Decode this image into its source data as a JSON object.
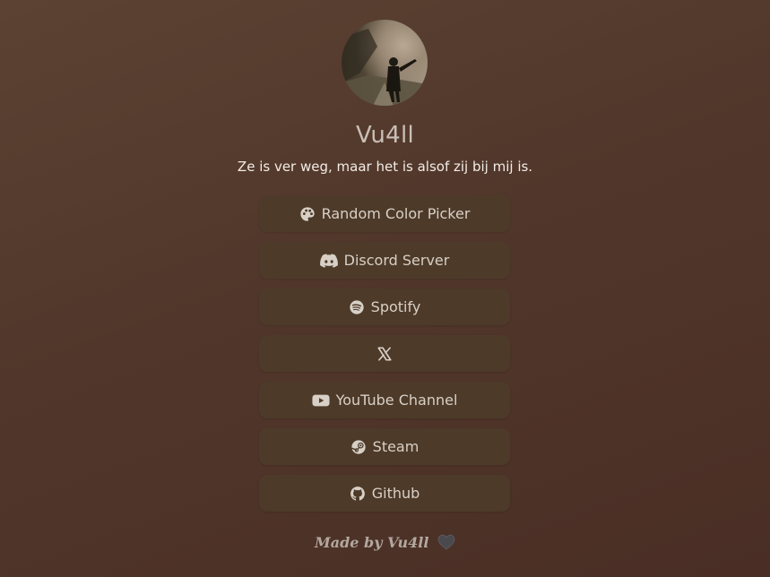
{
  "profile": {
    "username": "Vu4ll",
    "bio": "Ze is ver weg, maar het is alsof zij bij mij is."
  },
  "links": [
    {
      "label": "Random Color Picker",
      "icon": "palette-icon"
    },
    {
      "label": "Discord Server",
      "icon": "discord-icon"
    },
    {
      "label": "Spotify",
      "icon": "spotify-icon"
    },
    {
      "label": "",
      "icon": "x-icon"
    },
    {
      "label": "YouTube Channel",
      "icon": "youtube-icon"
    },
    {
      "label": "Steam",
      "icon": "steam-icon"
    },
    {
      "label": "Github",
      "icon": "github-icon"
    }
  ],
  "footer": {
    "text": "Made by Vu4ll",
    "icon": "heart-icon"
  },
  "colors": {
    "background": "#51372b",
    "button": "#4d3a29",
    "text": "#d8d0c6"
  }
}
